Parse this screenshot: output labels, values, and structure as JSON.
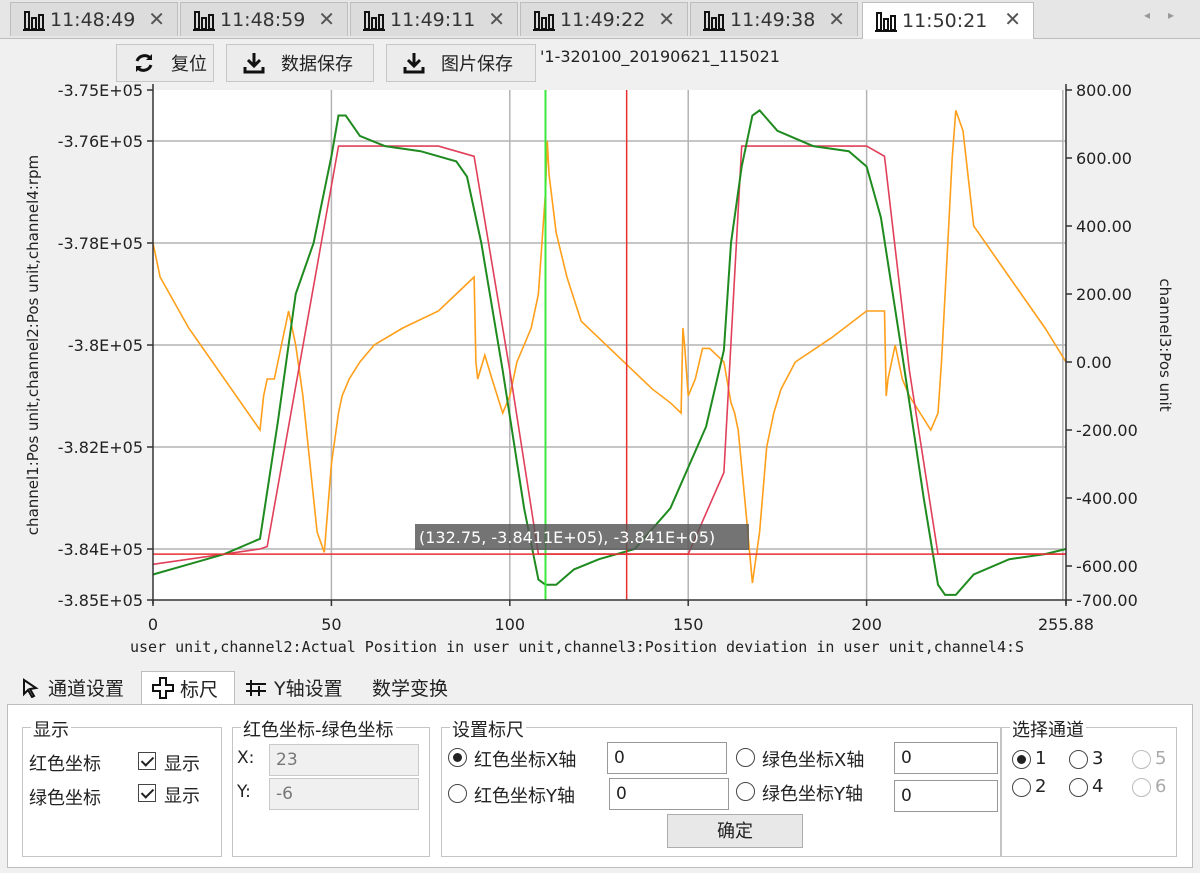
{
  "tabs": [
    {
      "label": "11:48:49",
      "active": false
    },
    {
      "label": "11:48:59",
      "active": false
    },
    {
      "label": "11:49:11",
      "active": false
    },
    {
      "label": "11:49:22",
      "active": false
    },
    {
      "label": "11:49:38",
      "active": false
    },
    {
      "label": "11:50:21",
      "active": true
    }
  ],
  "tab_scroll": {
    "left": "◂",
    "right": "▸"
  },
  "toolbar": {
    "reset_label": "复位",
    "save_data_label": "数据保存",
    "save_image_label": "图片保存",
    "filename": "'1-320100_20190621_115021"
  },
  "chart_data": {
    "type": "line",
    "y_left_label": "channel1:Pos unit,channel2:Pos unit,channel4:rpm",
    "y_right_label": "channel3:Pos unit",
    "x_axis_label": "user unit,channel2:Actual Position in user unit,channel3:Position deviation in user unit,channel4:S",
    "x_ticks": [
      "0",
      "50",
      "100",
      "150",
      "200",
      "255.88"
    ],
    "xlim": [
      0,
      255.88
    ],
    "y_left_ticks": [
      "-3.75E+05",
      "-3.76E+05",
      "-3.78E+05",
      "-3.8E+05",
      "-3.82E+05",
      "-3.84E+05",
      "-3.85E+05"
    ],
    "y_left_values": [
      -375000,
      -376000,
      -378000,
      -380000,
      -382000,
      -384000,
      -385000
    ],
    "ylim_left": [
      -385000,
      -375000
    ],
    "y_right_ticks": [
      "800.00",
      "600.00",
      "400.00",
      "200.00",
      "0.00",
      "-200.00",
      "-400.00",
      "-600.00",
      "-700.00"
    ],
    "y_right_values": [
      800,
      600,
      400,
      200,
      0,
      -200,
      -400,
      -600,
      -700
    ],
    "ylim_right": [
      -700,
      800
    ],
    "grid": true,
    "cursor_tooltip": "(132.75, -3.8411E+05), -3.841E+05)",
    "colors": {
      "green": "#1f8a1f",
      "red": "#e0405a",
      "orange": "#ff9f1a",
      "green_cursor": "#3ce83c",
      "red_cursor": "#e83030"
    },
    "green_cursor_x": 110,
    "red_cursor_x": 132.75,
    "red_h_cursor_y": -384100,
    "series": [
      {
        "color_key": "red",
        "axis": "left",
        "x": [
          0,
          30,
          32,
          52,
          60,
          80,
          90,
          100,
          108,
          120,
          140,
          150,
          160,
          165,
          175,
          200,
          205,
          212,
          220,
          240,
          255.88
        ],
        "y": [
          -384300,
          -384000,
          -383950,
          -376100,
          -376100,
          -376100,
          -376300,
          -380500,
          -384100,
          -384100,
          -384100,
          -384100,
          -382500,
          -376100,
          -376100,
          -376100,
          -376300,
          -380500,
          -384100,
          -384100,
          -384100
        ]
      },
      {
        "color_key": "green",
        "axis": "left",
        "x": [
          0,
          10,
          20,
          30,
          35,
          40,
          45,
          50,
          52,
          54,
          58,
          65,
          75,
          85,
          88,
          92,
          98,
          104,
          108,
          110,
          113,
          118,
          125,
          135,
          145,
          155,
          160,
          162,
          165,
          168,
          170,
          175,
          185,
          195,
          200,
          204,
          210,
          216,
          220,
          222,
          225,
          230,
          240,
          250,
          255.88
        ],
        "y": [
          -384500,
          -384300,
          -384100,
          -383800,
          -381500,
          -379000,
          -378000,
          -376300,
          -375500,
          -375500,
          -375900,
          -376100,
          -376200,
          -376400,
          -376700,
          -378000,
          -380500,
          -383200,
          -384600,
          -384700,
          -384700,
          -384400,
          -384200,
          -384000,
          -383200,
          -381600,
          -380100,
          -378000,
          -376500,
          -375500,
          -375400,
          -375800,
          -376100,
          -376200,
          -376500,
          -377500,
          -380200,
          -383000,
          -384700,
          -384900,
          -384900,
          -384500,
          -384200,
          -384100,
          -384000
        ]
      },
      {
        "color_key": "orange",
        "axis": "right",
        "x": [
          0,
          2,
          10,
          20,
          30,
          31,
          32,
          34,
          38,
          40,
          42,
          44,
          46,
          48,
          50,
          52,
          53,
          55,
          58,
          62,
          70,
          80,
          85,
          90,
          90.5,
          91,
          93,
          95,
          98,
          100,
          102,
          104,
          106,
          108,
          110,
          110.5,
          111,
          113,
          116,
          120,
          130,
          140,
          145,
          148,
          148.5,
          149,
          150,
          152,
          154,
          156,
          158,
          160,
          162,
          163,
          164,
          166,
          168,
          170,
          172,
          174,
          176,
          180,
          190,
          200,
          205,
          205.5,
          206,
          208,
          210,
          212,
          215,
          218,
          220,
          221,
          222,
          223,
          224,
          225,
          227,
          230,
          240,
          250,
          255.88
        ],
        "y": [
          350,
          250,
          100,
          -50,
          -200,
          -100,
          -50,
          -50,
          150,
          50,
          -100,
          -300,
          -500,
          -560,
          -300,
          -150,
          -100,
          -50,
          0,
          50,
          100,
          150,
          200,
          250,
          0,
          -50,
          20,
          -50,
          -150,
          -100,
          0,
          50,
          100,
          200,
          500,
          650,
          550,
          380,
          250,
          120,
          20,
          -80,
          -120,
          -150,
          100,
          50,
          -100,
          -50,
          40,
          40,
          20,
          0,
          -120,
          -150,
          -200,
          -420,
          -650,
          -500,
          -250,
          -150,
          -80,
          0,
          70,
          150,
          150,
          -100,
          -50,
          50,
          -50,
          -100,
          -150,
          -200,
          -150,
          0,
          200,
          400,
          600,
          740,
          680,
          400,
          250,
          100,
          0
        ]
      }
    ]
  },
  "bottom_tabs": [
    {
      "label": "通道设置",
      "active": false,
      "icon": "cursor-icon"
    },
    {
      "label": "标尺",
      "active": true,
      "icon": "crosshair-icon"
    },
    {
      "label": "Y轴设置",
      "active": false,
      "icon": "axis-icon"
    },
    {
      "label": "数学变换",
      "active": false,
      "icon": ""
    }
  ],
  "display_group": {
    "title": "显示",
    "red_coord_label": "红色坐标",
    "green_coord_label": "绿色坐标",
    "show_label": "显示",
    "red_show_checked": true,
    "green_show_checked": true
  },
  "diff_group": {
    "title": "红色坐标-绿色坐标",
    "x_label": "X:",
    "y_label": "Y:",
    "x_value": "23",
    "y_value": "-6"
  },
  "set_ruler_group": {
    "title": "设置标尺",
    "red_x_label": "红色坐标X轴",
    "red_y_label": "红色坐标Y轴",
    "green_x_label": "绿色坐标X轴",
    "green_y_label": "绿色坐标Y轴",
    "red_x_value": "0",
    "red_y_value": "0",
    "green_x_value": "0",
    "green_y_value": "0",
    "selected": "red_x",
    "ok_label": "确定"
  },
  "channel_group": {
    "title": "选择通道",
    "channels": [
      "1",
      "3",
      "5",
      "2",
      "4",
      "6"
    ],
    "selected": "1",
    "disabled": [
      "5",
      "6"
    ]
  }
}
